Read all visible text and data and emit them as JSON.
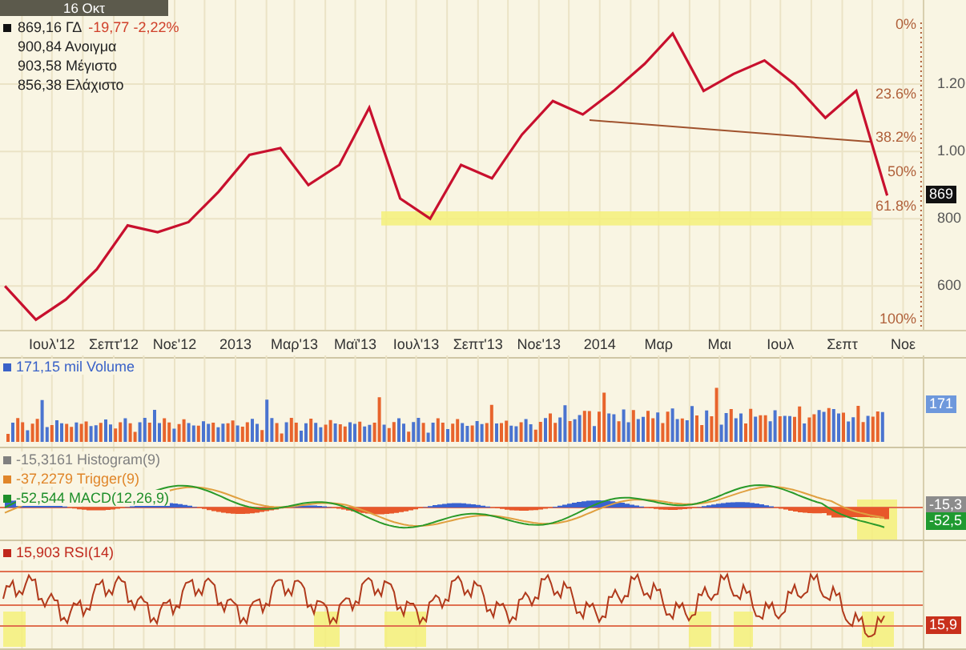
{
  "header": {
    "date": "16 Οκτ"
  },
  "quote": {
    "last": "869,16 ΓΔ",
    "change": "-19,77 -2,22%",
    "details": [
      "900,84 Ανοιγμα",
      "903,58 Μέγιστο",
      "856,38 Ελάχιστο"
    ]
  },
  "price_chart": {
    "price_tag": "869",
    "fibonacci_levels": [
      {
        "label": "0%"
      },
      {
        "label": "23.6%"
      },
      {
        "label": "38.2%"
      },
      {
        "label": "50%"
      },
      {
        "label": "61.8%"
      },
      {
        "label": "100%"
      }
    ],
    "cut_axis_labels": [
      "1.20",
      "1.00"
    ],
    "chart_data": {
      "type": "line",
      "xlim": [
        "2012-05-10",
        "2015-01-03"
      ],
      "ylim": [
        470,
        1450
      ],
      "grid": true,
      "bands": [
        {
          "axis": "y",
          "from": 780,
          "to": 822,
          "color": "#f5f07a"
        }
      ],
      "ref_lines": [
        {
          "axis": "x",
          "value": "2014-11-19",
          "color": "#b0603a"
        }
      ],
      "x": [
        "2012-05-15",
        "2012-06-15",
        "2012-07-15",
        "2012-08-15",
        "2012-09-15",
        "2012-10-15",
        "2012-11-15",
        "2012-12-15",
        "2013-01-15",
        "2013-02-15",
        "2013-03-15",
        "2013-04-15",
        "2013-05-15",
        "2013-06-15",
        "2013-07-15",
        "2013-08-15",
        "2013-09-15",
        "2013-10-15",
        "2013-11-15",
        "2013-12-15",
        "2014-01-15",
        "2014-02-15",
        "2014-03-15",
        "2014-04-15",
        "2014-05-15",
        "2014-06-15",
        "2014-07-15",
        "2014-08-15",
        "2014-09-15",
        "2014-10-16"
      ],
      "series": [
        {
          "color": "#c8102e",
          "values": [
            600,
            500,
            560,
            650,
            780,
            760,
            790,
            880,
            990,
            1010,
            900,
            960,
            1130,
            860,
            800,
            960,
            920,
            1050,
            1150,
            1110,
            1180,
            1260,
            1350,
            1180,
            1230,
            1270,
            1200,
            1100,
            1180,
            869
          ]
        }
      ],
      "xticks": [
        {
          "value": "2012-07-01",
          "label": "Ιουλ'12"
        },
        {
          "value": "2012-09-01",
          "label": "Σεπτ'12"
        },
        {
          "value": "2012-11-01",
          "label": "Νοε'12"
        },
        {
          "value": "2013-01-01",
          "label": "2013"
        },
        {
          "value": "2013-03-01",
          "label": "Μαρ'13"
        },
        {
          "value": "2013-05-01",
          "label": "Μαϊ'13"
        },
        {
          "value": "2013-07-01",
          "label": "Ιουλ'13"
        },
        {
          "value": "2013-09-01",
          "label": "Σεπτ'13"
        },
        {
          "value": "2013-11-01",
          "label": "Νοε'13"
        },
        {
          "value": "2014-01-01",
          "label": "2014"
        },
        {
          "value": "2014-03-01",
          "label": "Μαρ"
        },
        {
          "value": "2014-05-01",
          "label": "Μαι"
        },
        {
          "value": "2014-07-01",
          "label": "Ιουλ"
        },
        {
          "value": "2014-09-01",
          "label": "Σεπτ"
        },
        {
          "value": "2014-11-01",
          "label": "Νοε"
        }
      ],
      "yticks": [
        800,
        600
      ]
    }
  },
  "panels": [
    {
      "kind": "volume",
      "legend": [
        {
          "text": "171,15 mil Volume",
          "color": "#3a62c8"
        }
      ],
      "tags": [
        {
          "text": "171",
          "color": "#6e98dc"
        }
      ]
    },
    {
      "kind": "macd",
      "legend": [
        {
          "text": "-15,3161 Histogram(9)",
          "color": "#808080"
        },
        {
          "text": "-37,2279 Trigger(9)",
          "color": "#e0862a"
        },
        {
          "text": "-52,544 MACD(12,26,9)",
          "color": "#1f8f2a"
        }
      ],
      "tags": [
        {
          "text": "-15,3",
          "color": "#8c8c8c"
        },
        {
          "text": "-52,5",
          "color": "#1f9a30"
        }
      ]
    },
    {
      "kind": "rsi",
      "legend": [
        {
          "text": "15,903 RSI(14)",
          "color": "#c0281c"
        }
      ],
      "tags": [
        {
          "text": "15,9",
          "color": "#c8301c"
        }
      ]
    }
  ]
}
